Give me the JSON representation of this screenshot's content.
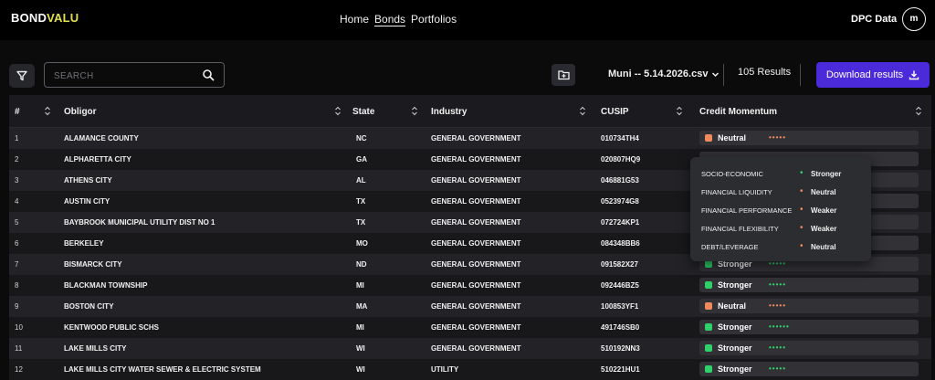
{
  "brand": {
    "part1": "BOND",
    "part2": "VALU"
  },
  "nav": {
    "items": [
      "Home",
      "Bonds",
      "Portfolios"
    ],
    "active": "Bonds"
  },
  "user": {
    "label": "DPC Data",
    "initial": "m"
  },
  "toolbar": {
    "search_placeholder": "SEARCH",
    "file_label": "Muni -- 5.14.2026.csv",
    "results": "105 Results",
    "download_label": "Download results"
  },
  "table": {
    "headers": {
      "num": "#",
      "obligor": "Obligor",
      "state": "State",
      "industry": "Industry",
      "cusip": "CUSIP",
      "momentum": "Credit Momentum"
    },
    "rows": [
      {
        "num": "1",
        "obligor": "ALAMANCE COUNTY",
        "state": "NC",
        "industry": "GENERAL GOVERNMENT",
        "cusip": "010734TH4",
        "momentum": "Neutral",
        "dots": "•••••"
      },
      {
        "num": "2",
        "obligor": "ALPHARETTA CITY",
        "state": "GA",
        "industry": "GENERAL GOVERNMENT",
        "cusip": "020807HQ9",
        "momentum": "",
        "dots": ""
      },
      {
        "num": "3",
        "obligor": "ATHENS CITY",
        "state": "AL",
        "industry": "GENERAL GOVERNMENT",
        "cusip": "046881G53",
        "momentum": "",
        "dots": ""
      },
      {
        "num": "4",
        "obligor": "AUSTIN CITY",
        "state": "TX",
        "industry": "GENERAL GOVERNMENT",
        "cusip": "0523974G8",
        "momentum": "",
        "dots": ""
      },
      {
        "num": "5",
        "obligor": "BAYBROOK MUNICIPAL UTILITY DIST NO 1",
        "state": "TX",
        "industry": "GENERAL GOVERNMENT",
        "cusip": "072724KP1",
        "momentum": "",
        "dots": ""
      },
      {
        "num": "6",
        "obligor": "BERKELEY",
        "state": "MO",
        "industry": "GENERAL GOVERNMENT",
        "cusip": "084348BB6",
        "momentum": "",
        "dots": ""
      },
      {
        "num": "7",
        "obligor": "BISMARCK CITY",
        "state": "ND",
        "industry": "GENERAL GOVERNMENT",
        "cusip": "091582X27",
        "momentum": "Stronger",
        "dots": "•••••"
      },
      {
        "num": "8",
        "obligor": "BLACKMAN TOWNSHIP",
        "state": "MI",
        "industry": "GENERAL GOVERNMENT",
        "cusip": "092446BZ5",
        "momentum": "Stronger",
        "dots": "•••••"
      },
      {
        "num": "9",
        "obligor": "BOSTON CITY",
        "state": "MA",
        "industry": "GENERAL GOVERNMENT",
        "cusip": "100853YF1",
        "momentum": "Neutral",
        "dots": "•••••"
      },
      {
        "num": "10",
        "obligor": "KENTWOOD PUBLIC SCHS",
        "state": "MI",
        "industry": "GENERAL GOVERNMENT",
        "cusip": "491746SB0",
        "momentum": "Stronger",
        "dots": "••••••"
      },
      {
        "num": "11",
        "obligor": "LAKE MILLS CITY",
        "state": "WI",
        "industry": "GENERAL GOVERNMENT",
        "cusip": "510192NN3",
        "momentum": "Stronger",
        "dots": "•••••"
      },
      {
        "num": "12",
        "obligor": "LAKE MILLS CITY WATER SEWER & ELECTRIC SYSTEM",
        "state": "WI",
        "industry": "UTILITY",
        "cusip": "510221HU1",
        "momentum": "Stronger",
        "dots": "•••••"
      }
    ]
  },
  "popover": {
    "items": [
      {
        "key": "SOCIO-ECONOMIC",
        "value": "Stronger"
      },
      {
        "key": "FINANCIAL LIQUIDITY",
        "value": "Neutral"
      },
      {
        "key": "FINANCIAL PERFORMANCE",
        "value": "Weaker"
      },
      {
        "key": "FINANCIAL FLEXIBILITY",
        "value": "Weaker"
      },
      {
        "key": "DEBT/LEVERAGE",
        "value": "Neutral"
      }
    ]
  },
  "colors": {
    "stronger": "#2fd16b",
    "neutral": "#f08a5d",
    "weaker": "#f08a5d",
    "accent": "#4b2ad9",
    "brand_accent": "#e2e24b"
  }
}
